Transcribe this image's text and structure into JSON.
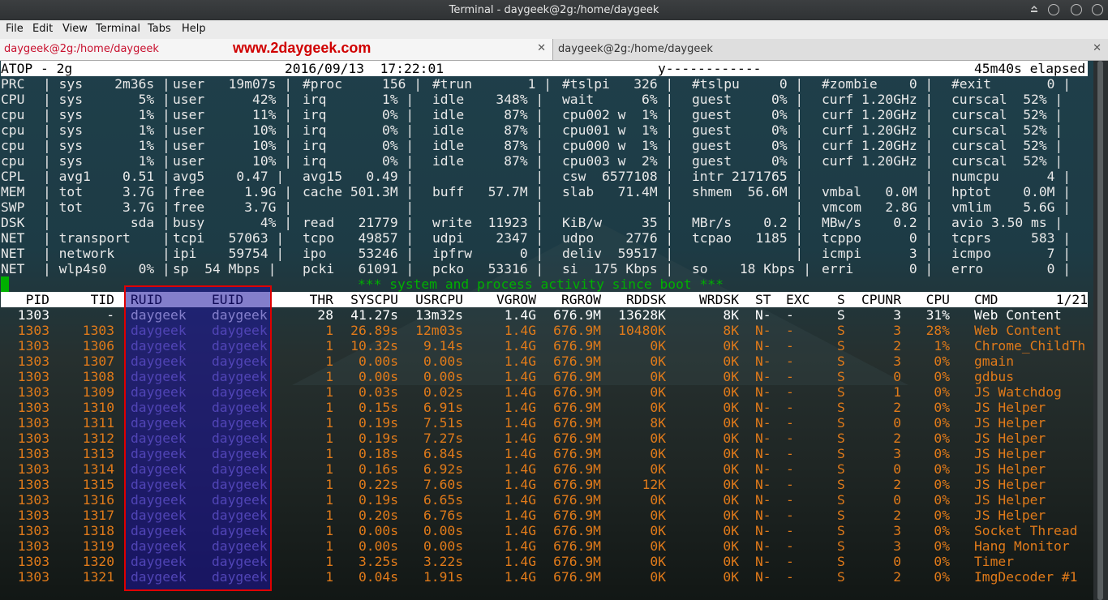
{
  "window": {
    "title": "Terminal - daygeek@2g:/home/daygeek",
    "watermark": "www.2daygeek.com"
  },
  "menu": [
    "File",
    "Edit",
    "View",
    "Terminal",
    "Tabs",
    "Help"
  ],
  "tabs": [
    {
      "label": "daygeek@2g:/home/daygeek",
      "active": true
    },
    {
      "label": "daygeek@2g:/home/daygeek",
      "active": false
    }
  ],
  "atop": {
    "header": [
      "ATOP - 2g",
      "2016/09/13  17:22:01",
      "y------------",
      "45m40s elapsed"
    ],
    "system_rows": [
      [
        "PRC",
        "| sys    2m36s |",
        "user   19m07s |",
        "#proc     156 |",
        "#trun       1 |",
        "#tslpi   326 |",
        "#tslpu     0 |",
        "#zombie    0 |",
        "#exit       0 |"
      ],
      [
        "CPU",
        "| sys       5% |",
        "user      42% |",
        "irq       1% |",
        "idle    348% |",
        "wait      6% |",
        "guest     0% |",
        "curf 1.20GHz |",
        "curscal  52% |"
      ],
      [
        "cpu",
        "| sys       1% |",
        "user      11% |",
        "irq       0% |",
        "idle     87% |",
        "cpu002 w  1% |",
        "guest     0% |",
        "curf 1.20GHz |",
        "curscal  52% |"
      ],
      [
        "cpu",
        "| sys       1% |",
        "user      10% |",
        "irq       0% |",
        "idle     87% |",
        "cpu001 w  1% |",
        "guest     0% |",
        "curf 1.20GHz |",
        "curscal  52% |"
      ],
      [
        "cpu",
        "| sys       1% |",
        "user      10% |",
        "irq       0% |",
        "idle     87% |",
        "cpu000 w  1% |",
        "guest     0% |",
        "curf 1.20GHz |",
        "curscal  52% |"
      ],
      [
        "cpu",
        "| sys       1% |",
        "user      10% |",
        "irq       0% |",
        "idle     87% |",
        "cpu003 w  2% |",
        "guest     0% |",
        "curf 1.20GHz |",
        "curscal  52% |"
      ],
      [
        "CPL",
        "| avg1    0.51 |",
        "avg5    0.47 |",
        "avg15   0.49 |",
        "             |",
        "csw  6577108 |",
        "intr 2171765 |",
        "             |",
        "numcpu      4 |"
      ],
      [
        "MEM",
        "| tot     3.7G |",
        "free     1.9G |",
        "cache 501.3M |",
        "buff   57.7M |",
        "slab   71.4M |",
        "shmem  56.6M |",
        "vmbal   0.0M |",
        "hptot    0.0M |"
      ],
      [
        "SWP",
        "| tot     3.7G |",
        "free     3.7G |",
        "             |",
        "             |",
        "             |",
        "             |",
        "vmcom   2.8G |",
        "vmlim    5.6G |"
      ],
      [
        "DSK",
        "|          sda |",
        "busy       4% |",
        "read   21779 |",
        "write  11923 |",
        "KiB/w     35 |",
        "MBr/s    0.2 |",
        "MBw/s    0.2 |",
        "avio 3.50 ms |"
      ],
      [
        "NET",
        "| transport    |",
        "tcpi   57063 |",
        "tcpo   49857 |",
        "udpi    2347 |",
        "udpo    2776 |",
        "tcpao   1185 |",
        "tcppo      0 |",
        "tcprs     583 |"
      ],
      [
        "NET",
        "| network      |",
        "ipi    59754 |",
        "ipo    53246 |",
        "ipfrw      0 |",
        "deliv  59517 |",
        "             |",
        "icmpi      3 |",
        "icmpo       7 |"
      ],
      [
        "NET",
        "| wlp4s0    0% |",
        "sp  54 Mbps |",
        "pcki   61091 |",
        "pcko   53316 |",
        "si  175 Kbps |",
        "so    18 Kbps |",
        "erri       0 |",
        "erro        0 |"
      ]
    ],
    "activity_message": "*** system and process activity since boot ***",
    "columns": [
      "PID",
      "TID",
      "RUID",
      "EUID",
      "THR",
      "SYSCPU",
      "USRCPU",
      "VGROW",
      "RGROW",
      "RDDSK",
      "WRDSK",
      "ST",
      "EXC",
      "S",
      "CPUNR",
      "CPU",
      "CMD",
      "1/21"
    ],
    "processes": [
      [
        "1303",
        "-",
        "daygeek",
        "daygeek",
        "28",
        "41.27s",
        "13m32s",
        "1.4G",
        "676.9M",
        "13628K",
        "8K",
        "N-",
        "-",
        "S",
        "3",
        "31%",
        "Web Content"
      ],
      [
        "1303",
        "1303",
        "daygeek",
        "daygeek",
        "1",
        "26.89s",
        "12m03s",
        "1.4G",
        "676.9M",
        "10480K",
        "8K",
        "N-",
        "-",
        "S",
        "3",
        "28%",
        "Web Content"
      ],
      [
        "1303",
        "1306",
        "daygeek",
        "daygeek",
        "1",
        "10.32s",
        "9.14s",
        "1.4G",
        "676.9M",
        "0K",
        "0K",
        "N-",
        "-",
        "S",
        "2",
        "1%",
        "Chrome_ChildTh"
      ],
      [
        "1303",
        "1307",
        "daygeek",
        "daygeek",
        "1",
        "0.00s",
        "0.00s",
        "1.4G",
        "676.9M",
        "0K",
        "0K",
        "N-",
        "-",
        "S",
        "3",
        "0%",
        "gmain"
      ],
      [
        "1303",
        "1308",
        "daygeek",
        "daygeek",
        "1",
        "0.00s",
        "0.00s",
        "1.4G",
        "676.9M",
        "0K",
        "0K",
        "N-",
        "-",
        "S",
        "0",
        "0%",
        "gdbus"
      ],
      [
        "1303",
        "1309",
        "daygeek",
        "daygeek",
        "1",
        "0.03s",
        "0.02s",
        "1.4G",
        "676.9M",
        "0K",
        "0K",
        "N-",
        "-",
        "S",
        "1",
        "0%",
        "JS Watchdog"
      ],
      [
        "1303",
        "1310",
        "daygeek",
        "daygeek",
        "1",
        "0.15s",
        "6.91s",
        "1.4G",
        "676.9M",
        "0K",
        "0K",
        "N-",
        "-",
        "S",
        "2",
        "0%",
        "JS Helper"
      ],
      [
        "1303",
        "1311",
        "daygeek",
        "daygeek",
        "1",
        "0.19s",
        "7.51s",
        "1.4G",
        "676.9M",
        "8K",
        "0K",
        "N-",
        "-",
        "S",
        "0",
        "0%",
        "JS Helper"
      ],
      [
        "1303",
        "1312",
        "daygeek",
        "daygeek",
        "1",
        "0.19s",
        "7.27s",
        "1.4G",
        "676.9M",
        "0K",
        "0K",
        "N-",
        "-",
        "S",
        "2",
        "0%",
        "JS Helper"
      ],
      [
        "1303",
        "1313",
        "daygeek",
        "daygeek",
        "1",
        "0.18s",
        "6.84s",
        "1.4G",
        "676.9M",
        "0K",
        "0K",
        "N-",
        "-",
        "S",
        "3",
        "0%",
        "JS Helper"
      ],
      [
        "1303",
        "1314",
        "daygeek",
        "daygeek",
        "1",
        "0.16s",
        "6.92s",
        "1.4G",
        "676.9M",
        "0K",
        "0K",
        "N-",
        "-",
        "S",
        "0",
        "0%",
        "JS Helper"
      ],
      [
        "1303",
        "1315",
        "daygeek",
        "daygeek",
        "1",
        "0.22s",
        "7.60s",
        "1.4G",
        "676.9M",
        "12K",
        "0K",
        "N-",
        "-",
        "S",
        "2",
        "0%",
        "JS Helper"
      ],
      [
        "1303",
        "1316",
        "daygeek",
        "daygeek",
        "1",
        "0.19s",
        "6.65s",
        "1.4G",
        "676.9M",
        "0K",
        "0K",
        "N-",
        "-",
        "S",
        "0",
        "0%",
        "JS Helper"
      ],
      [
        "1303",
        "1317",
        "daygeek",
        "daygeek",
        "1",
        "0.20s",
        "6.76s",
        "1.4G",
        "676.9M",
        "0K",
        "0K",
        "N-",
        "-",
        "S",
        "2",
        "0%",
        "JS Helper"
      ],
      [
        "1303",
        "1318",
        "daygeek",
        "daygeek",
        "1",
        "0.00s",
        "0.00s",
        "1.4G",
        "676.9M",
        "0K",
        "0K",
        "N-",
        "-",
        "S",
        "3",
        "0%",
        "Socket Thread"
      ],
      [
        "1303",
        "1319",
        "daygeek",
        "daygeek",
        "1",
        "0.00s",
        "0.00s",
        "1.4G",
        "676.9M",
        "0K",
        "0K",
        "N-",
        "-",
        "S",
        "3",
        "0%",
        "Hang Monitor"
      ],
      [
        "1303",
        "1320",
        "daygeek",
        "daygeek",
        "1",
        "3.25s",
        "3.22s",
        "1.4G",
        "676.9M",
        "0K",
        "0K",
        "N-",
        "-",
        "S",
        "0",
        "0%",
        "Timer"
      ],
      [
        "1303",
        "1321",
        "daygeek",
        "daygeek",
        "1",
        "0.04s",
        "1.91s",
        "1.4G",
        "676.9M",
        "0K",
        "0K",
        "N-",
        "-",
        "S",
        "2",
        "0%",
        "ImgDecoder #1"
      ]
    ]
  }
}
